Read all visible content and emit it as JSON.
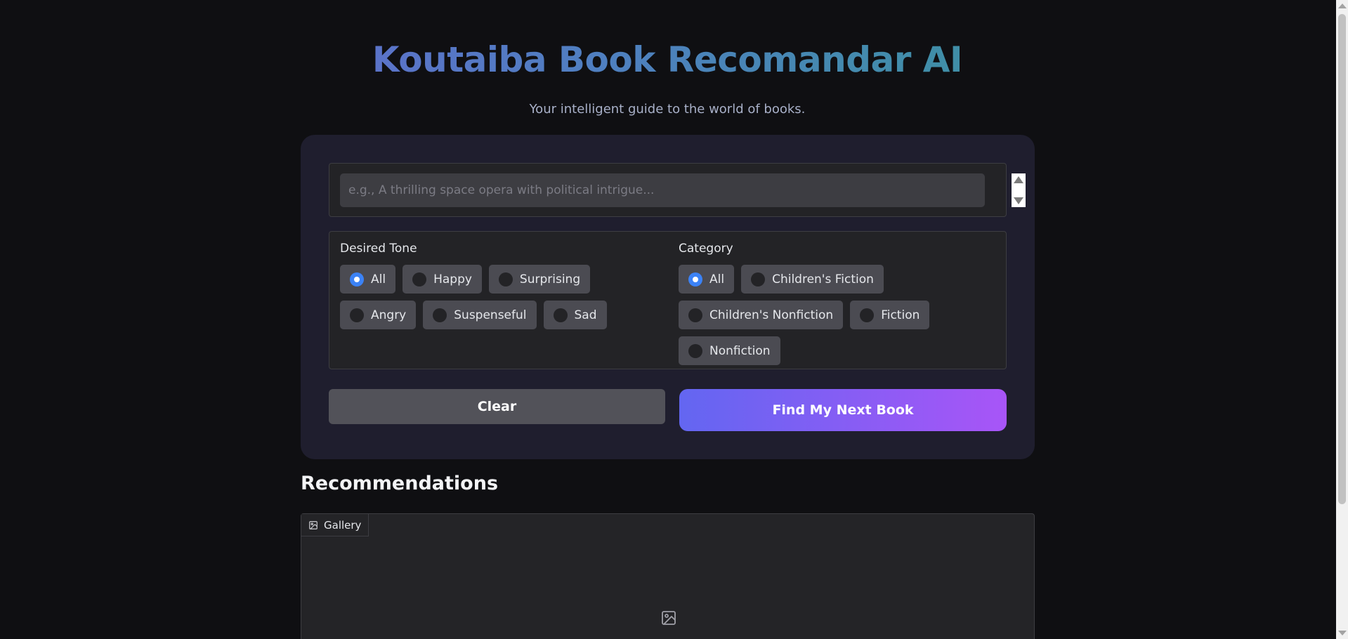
{
  "header": {
    "title": "Koutaiba Book Recomandar AI",
    "subtitle": "Your intelligent guide to the world of books."
  },
  "query": {
    "placeholder": "e.g., A thrilling space opera with political intrigue...",
    "value": ""
  },
  "tone": {
    "label": "Desired Tone",
    "selected": "All",
    "options": [
      "All",
      "Happy",
      "Surprising",
      "Angry",
      "Suspenseful",
      "Sad"
    ]
  },
  "category": {
    "label": "Category",
    "selected": "All",
    "options": [
      "All",
      "Children's Fiction",
      "Children's Nonfiction",
      "Fiction",
      "Nonfiction"
    ]
  },
  "buttons": {
    "clear_label": "Clear",
    "find_label": "Find My Next Book"
  },
  "recommendations": {
    "title": "Recommendations",
    "gallery_tab_label": "Gallery"
  },
  "colors": {
    "accent": "#3b82f6",
    "find_gradient_start": "#6366f1",
    "find_gradient_end": "#a855f7",
    "card_bg": "#1f1e2e",
    "page_bg": "#0f0f12"
  }
}
